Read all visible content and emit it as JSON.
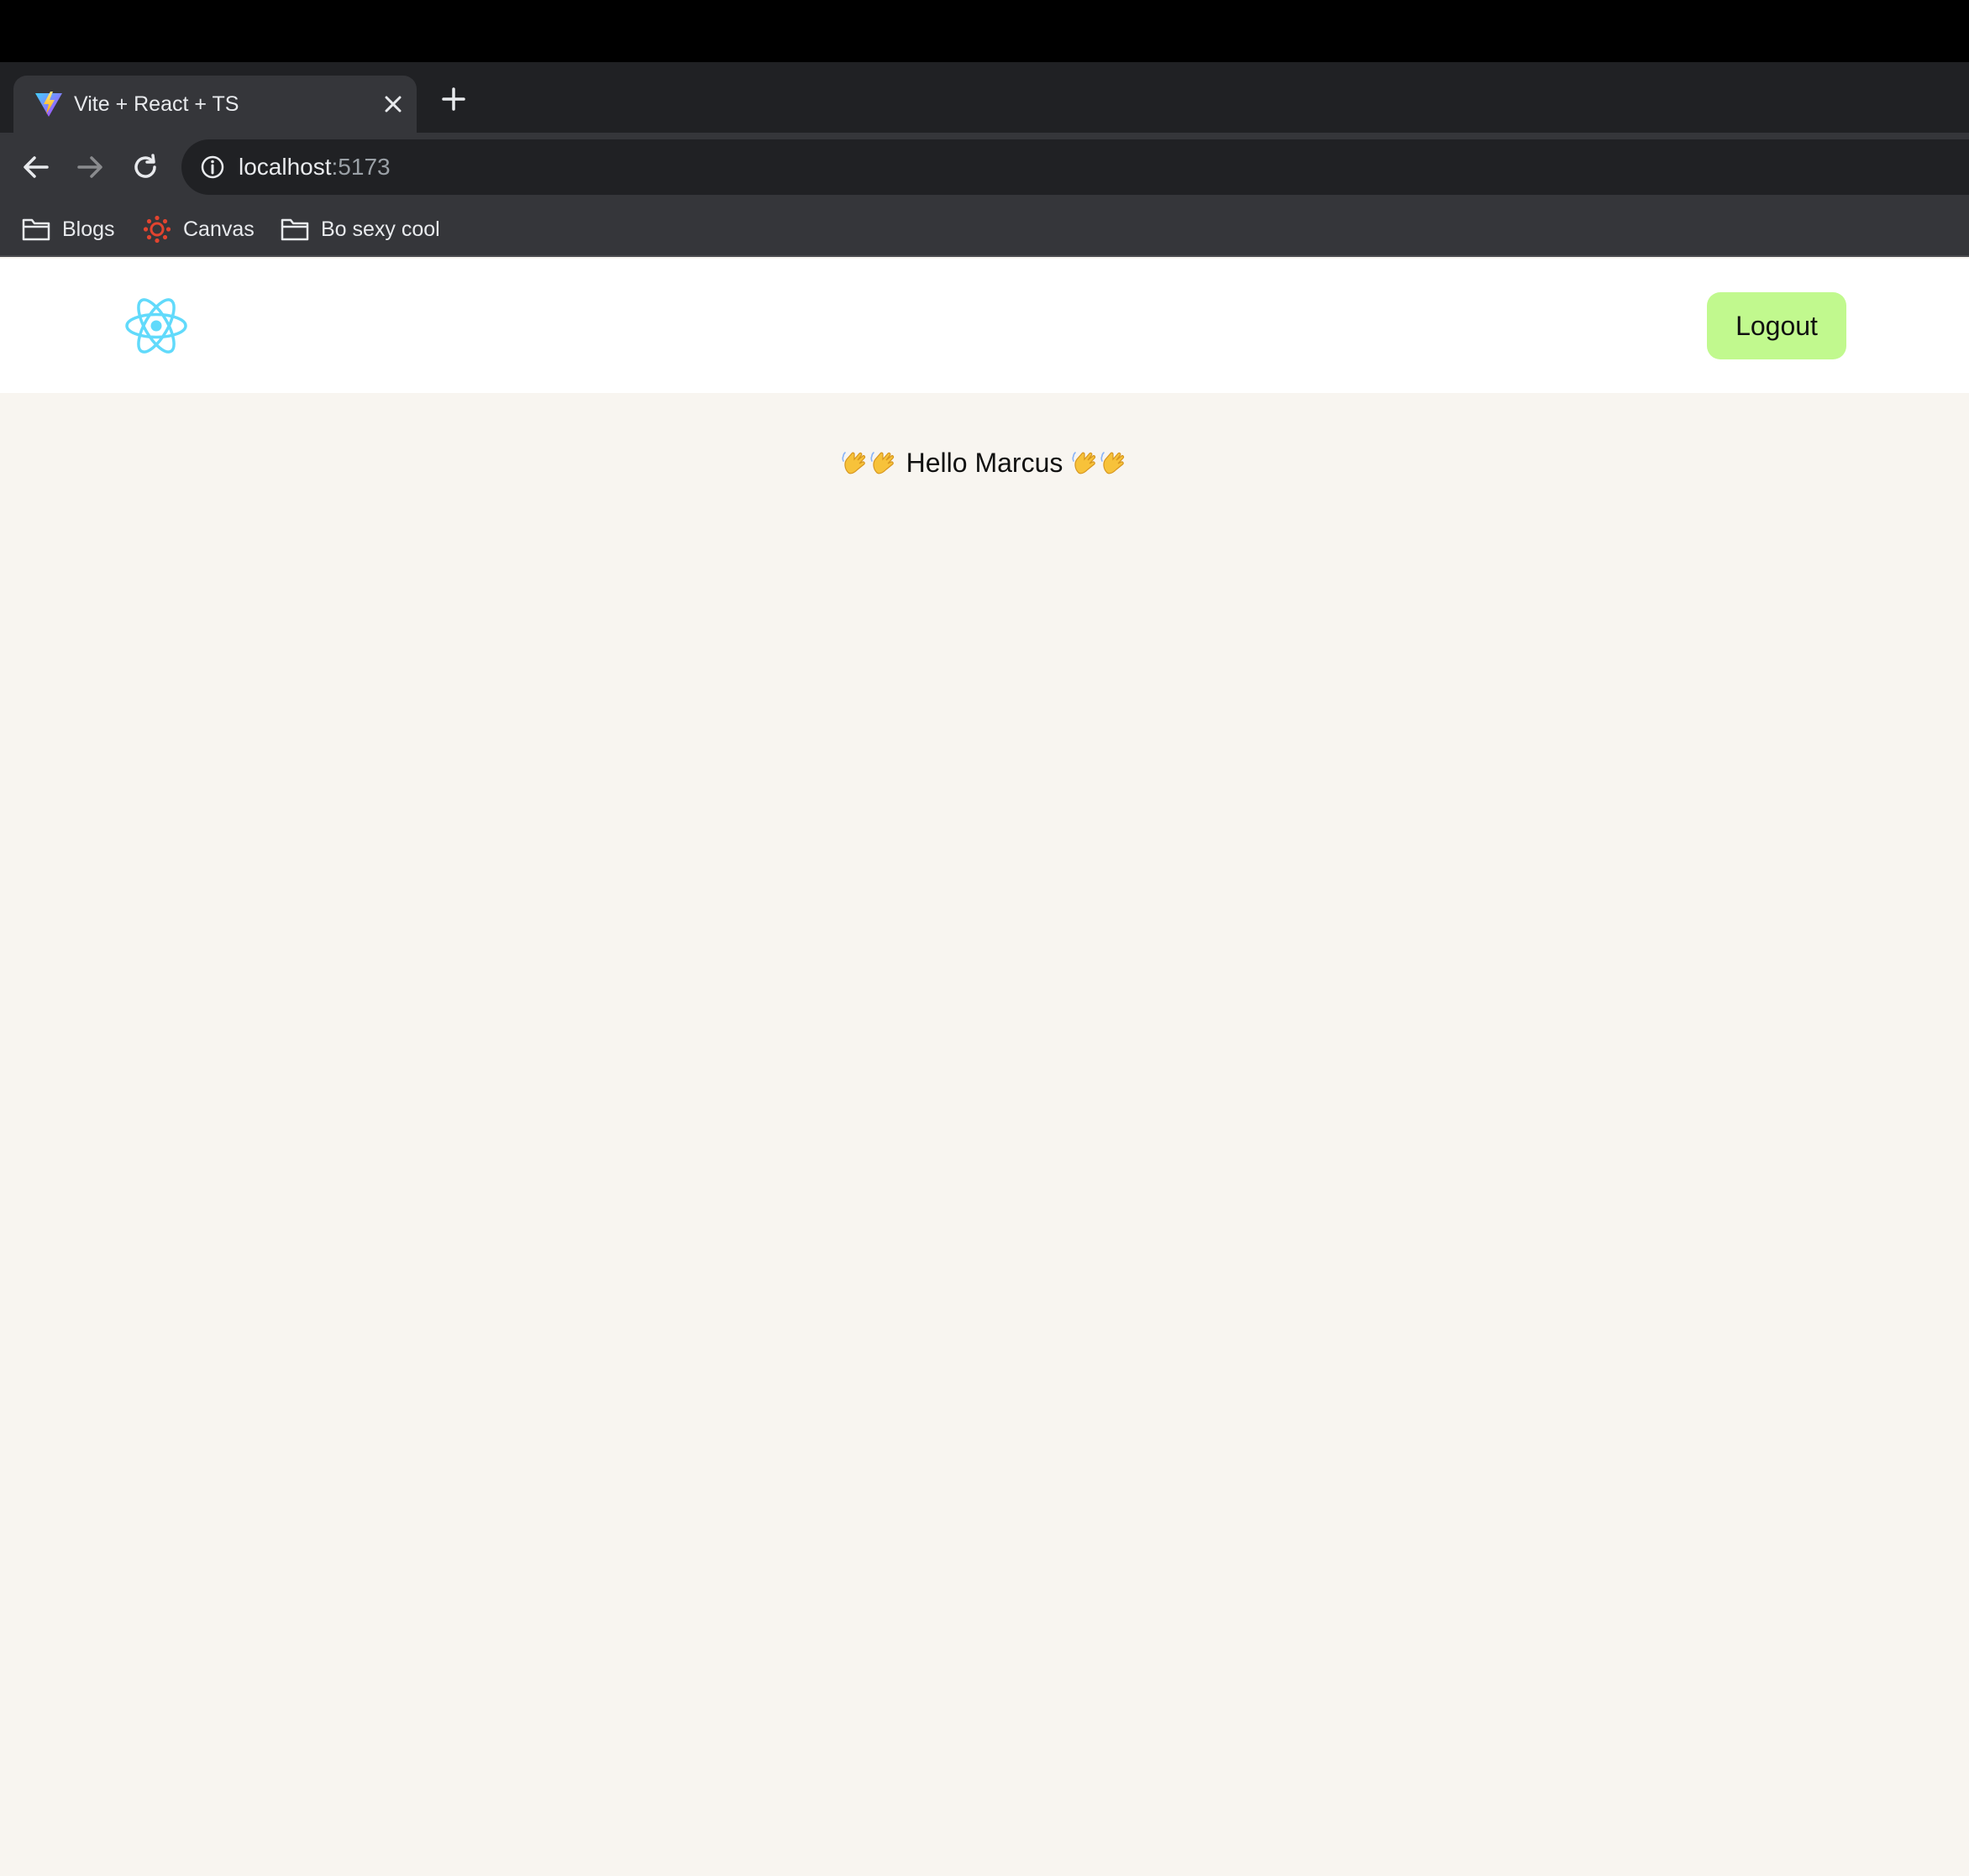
{
  "browser": {
    "tab": {
      "title": "Vite + React + TS",
      "favicon": "vite-logo-icon"
    },
    "address": {
      "host": "localhost",
      "port": ":5173"
    },
    "bookmarks": [
      {
        "label": "Blogs",
        "icon": "folder-icon"
      },
      {
        "label": "Canvas",
        "icon": "canvas-logo-icon"
      },
      {
        "label": "Bo sexy cool",
        "icon": "folder-icon"
      }
    ]
  },
  "app": {
    "logout_label": "Logout",
    "greeting_name": "Hello Marcus",
    "greeting_emoji": "waving-hand-icon",
    "logo": "react-logo-icon",
    "colors": {
      "logout_bg": "#c1f98e",
      "page_bg": "#f8f5f0",
      "react_blue": "#61dafb"
    }
  }
}
